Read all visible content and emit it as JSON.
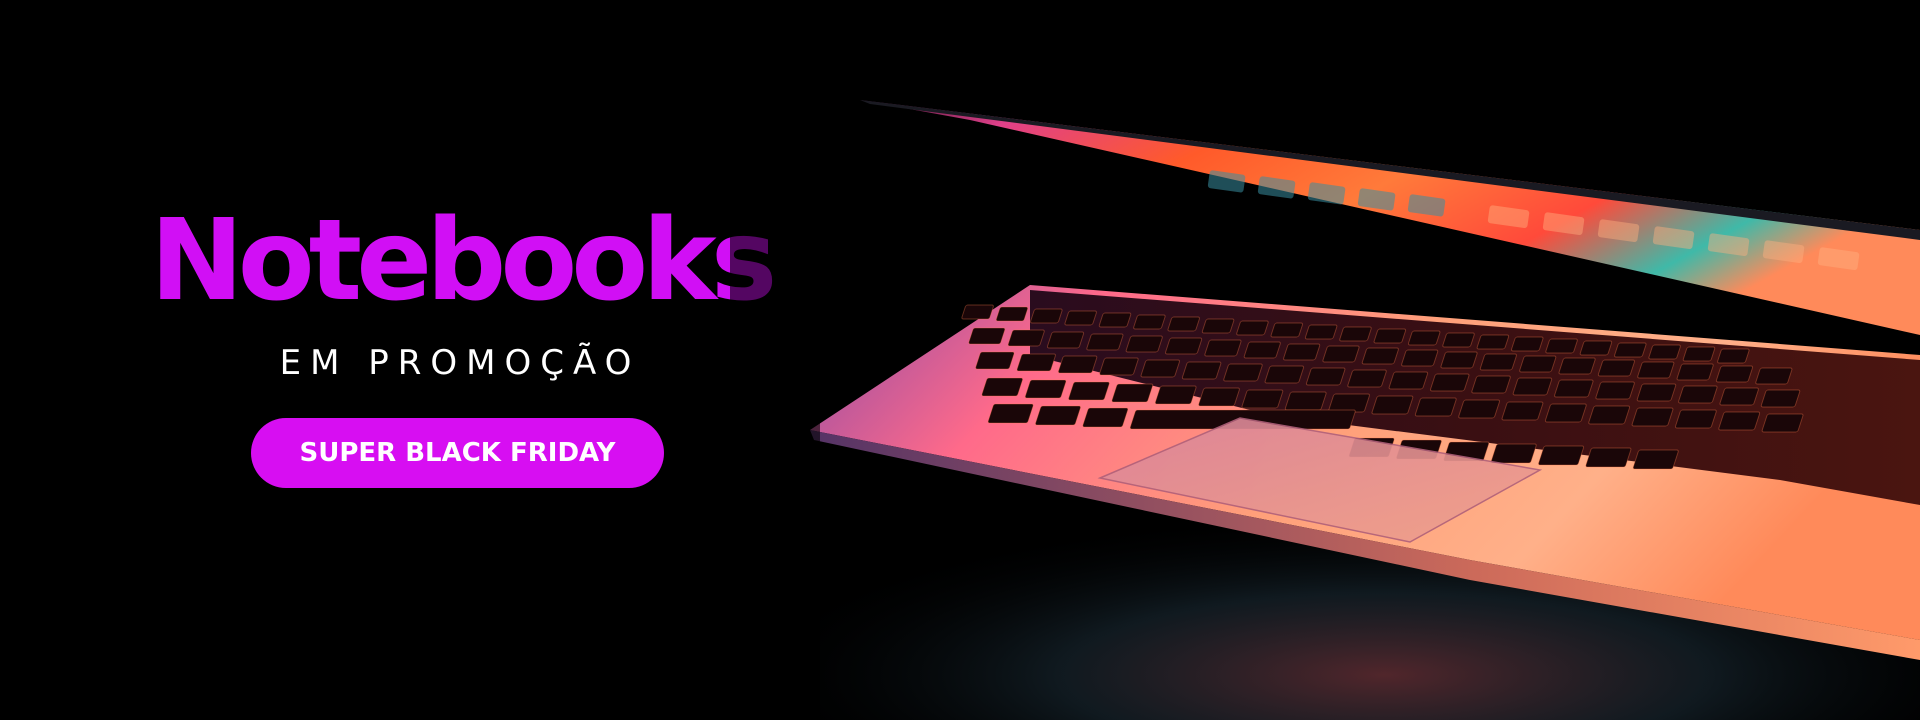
{
  "banner": {
    "headline": "Notebooks",
    "subhead": "EM PROMOÇÃO",
    "cta_label": "SUPER BLACK FRIDAY",
    "photo_subject": "laptop-photo"
  },
  "colors": {
    "background": "#000000",
    "headline": "#d10ff5",
    "cta_background": "#d70ef2",
    "cta_text": "#ffffff",
    "subhead": "#ffffff"
  }
}
